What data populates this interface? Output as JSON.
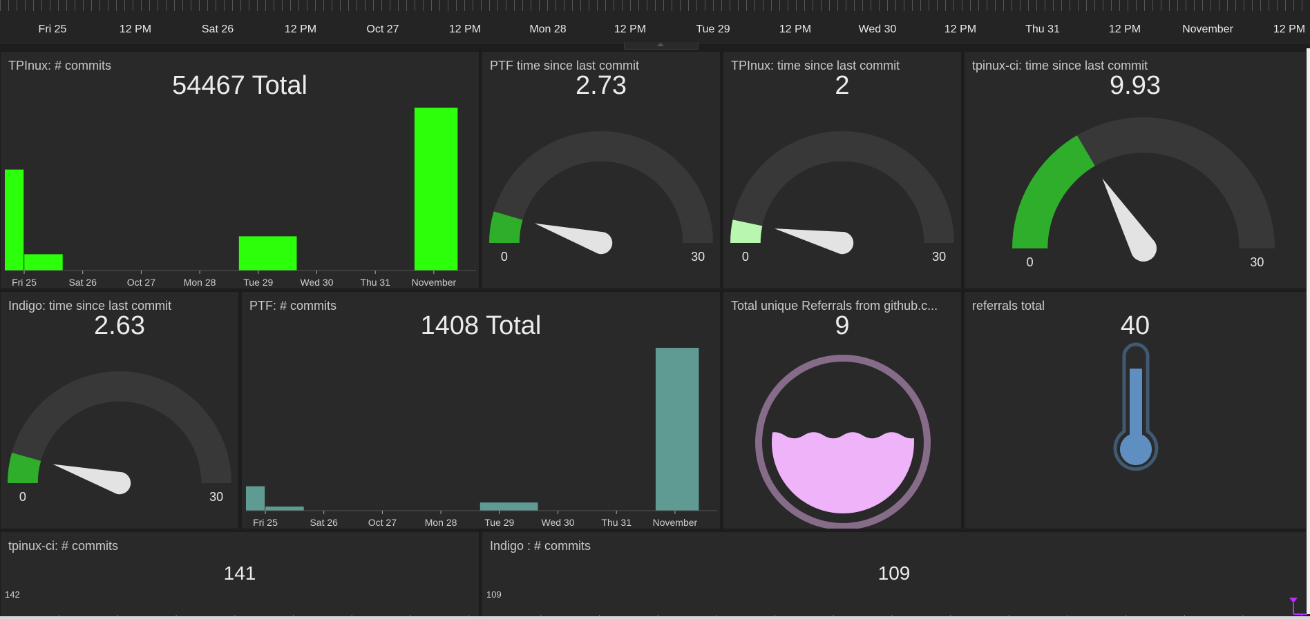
{
  "timeline": {
    "labels": [
      "Fri 25",
      "12 PM",
      "Sat 26",
      "12 PM",
      "Oct 27",
      "12 PM",
      "Mon 28",
      "12 PM",
      "Tue 29",
      "12 PM",
      "Wed 30",
      "12 PM",
      "Thu 31",
      "12 PM",
      "November",
      "12 PM"
    ]
  },
  "panels": {
    "tplnux_commits": {
      "title": "TPInux: # commits",
      "value": "54467 Total",
      "chart_data": {
        "type": "bar",
        "categories": [
          "Fri 25",
          "Sat 26",
          "Oct 27",
          "Mon 28",
          "Tue 29",
          "Wed 30",
          "Thu 31",
          "November"
        ],
        "bars": [
          {
            "start": "Fri 25 00:00",
            "end": "Fri 25 08:00",
            "value": 0.62
          },
          {
            "start": "Fri 25 08:00",
            "end": "Sat 26 00:00",
            "value": 0.1
          },
          {
            "start": "Tue 29 00:00",
            "end": "Wed 30 00:00",
            "value": 0.21
          },
          {
            "start": "Nov 01 00:00",
            "end": "Nov 01 18:00",
            "value": 1.0
          }
        ],
        "color": "#2bff0a"
      }
    },
    "ptf_time": {
      "title": "PTF time since last commit",
      "value": "2.73",
      "gauge": {
        "min": "0",
        "max": "30",
        "current": 2.73,
        "fill_color": "#2fae2c"
      }
    },
    "tplnux_time": {
      "title": "TPInux: time since last commit",
      "value": "2",
      "gauge": {
        "min": "0",
        "max": "30",
        "current": 2,
        "fill_color": "#b9f7b0"
      }
    },
    "tpinuxci_time": {
      "title": "tpinux-ci: time since last commit",
      "value": "9.93",
      "gauge": {
        "min": "0",
        "max": "30",
        "current": 9.93,
        "fill_color": "#2fae2c"
      }
    },
    "indigo_time": {
      "title": "Indigo: time since last commit",
      "value": "2.63",
      "gauge": {
        "min": "0",
        "max": "30",
        "current": 2.63,
        "fill_color": "#2fae2c"
      }
    },
    "ptf_commits": {
      "title": "PTF: # commits",
      "value": "1408 Total",
      "chart_data": {
        "type": "bar",
        "categories": [
          "Fri 25",
          "Sat 26",
          "Oct 27",
          "Mon 28",
          "Tue 29",
          "Wed 30",
          "Thu 31",
          "November"
        ],
        "bars": [
          {
            "start": "Fri 25 00:00",
            "end": "Fri 25 08:00",
            "value": 0.15
          },
          {
            "start": "Fri 25 08:00",
            "end": "Sat 26 00:00",
            "value": 0.025
          },
          {
            "start": "Tue 29 00:00",
            "end": "Wed 30 00:00",
            "value": 0.05
          },
          {
            "start": "Nov 01 00:00",
            "end": "Nov 01 18:00",
            "value": 1.0
          }
        ],
        "color": "#5f9b93"
      }
    },
    "referrals_unique": {
      "title": "Total unique Referrals from github.c...",
      "value": "9",
      "liquid": {
        "level": 0.55,
        "fill_color": "#eeb3f8",
        "ring_color": "#876c8a"
      }
    },
    "referrals_total": {
      "title": "referrals total",
      "value": "40",
      "thermometer": {
        "level": 0.8,
        "fill_color": "#5f8fc0",
        "outline_color": "#3f5a72"
      }
    },
    "tpinuxci_commits": {
      "title": "tpinux-ci: # commits",
      "value": "141",
      "axis_top": "142"
    },
    "indigo_commits": {
      "title": "Indigo : # commits",
      "value": "109",
      "axis_top": "109"
    }
  },
  "colors": {
    "background": "#1d1d1d",
    "panel": "#292929",
    "gauge_track": "#383838",
    "needle": "#e3e3e3"
  }
}
